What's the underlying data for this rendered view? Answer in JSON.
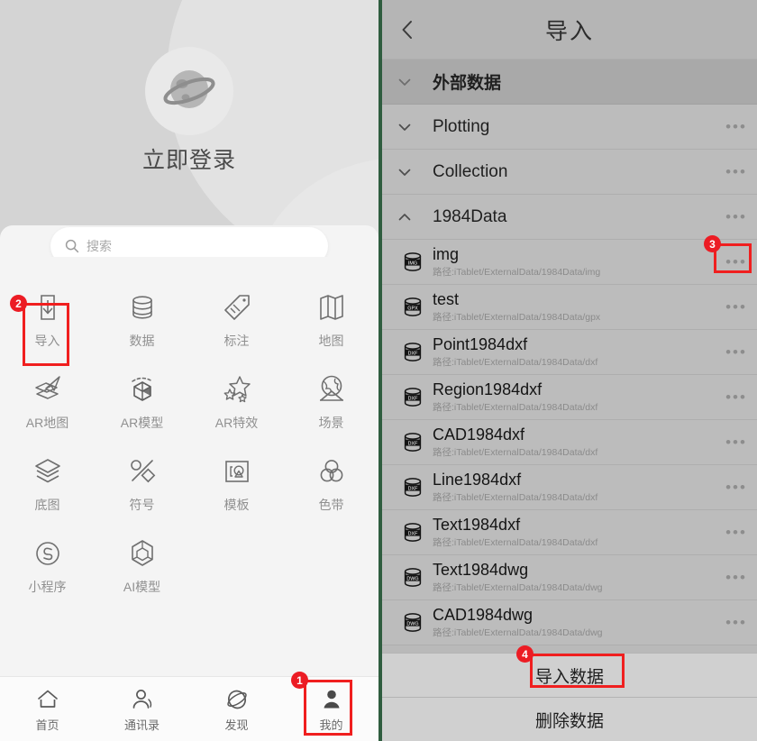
{
  "left": {
    "hero": {
      "avatar_icon": "planet-avatar-icon",
      "login_label": "立即登录"
    },
    "search": {
      "icon": "search-icon",
      "placeholder": "搜索",
      "value": ""
    },
    "grid": [
      {
        "icon": "import-download-icon",
        "label": "导入"
      },
      {
        "icon": "database-icon",
        "label": "数据"
      },
      {
        "icon": "tag-annotation-icon",
        "label": "标注"
      },
      {
        "icon": "map-icon",
        "label": "地图"
      },
      {
        "icon": "ar-map-icon",
        "label": "AR地图"
      },
      {
        "icon": "ar-model-cube-icon",
        "label": "AR模型"
      },
      {
        "icon": "ar-effect-stars-icon",
        "label": "AR特效"
      },
      {
        "icon": "scene-globe-icon",
        "label": "场景"
      },
      {
        "icon": "basemap-layers-icon",
        "label": "底图"
      },
      {
        "icon": "symbol-percent-icon",
        "label": "符号"
      },
      {
        "icon": "template-frame-icon",
        "label": "模板"
      },
      {
        "icon": "colorband-circles-icon",
        "label": "色带"
      },
      {
        "icon": "miniprogram-s-icon",
        "label": "小程序"
      },
      {
        "icon": "ai-model-cube-icon",
        "label": "AI模型"
      }
    ],
    "tabs": [
      {
        "icon": "home-icon",
        "label": "首页"
      },
      {
        "icon": "contacts-icon",
        "label": "通讯录"
      },
      {
        "icon": "discover-icon",
        "label": "发现"
      },
      {
        "icon": "profile-icon",
        "label": "我的"
      }
    ]
  },
  "right": {
    "header": {
      "back_icon": "back-chevron-icon",
      "title": "导入"
    },
    "folders": [
      {
        "name": "外部数据",
        "chevron": "chevron-down-icon",
        "section": true,
        "dots": ""
      },
      {
        "name": "Plotting",
        "chevron": "chevron-down-icon",
        "section": false,
        "dots": "•••"
      },
      {
        "name": "Collection",
        "chevron": "chevron-down-icon",
        "section": false,
        "dots": "•••"
      },
      {
        "name": "1984Data",
        "chevron": "chevron-up-icon",
        "section": false,
        "dots": "•••"
      }
    ],
    "files": [
      {
        "name": "img",
        "badge": "IMG",
        "path": "路径:iTablet/ExternalData/1984Data/img",
        "dots": "•••"
      },
      {
        "name": "test",
        "badge": "GPX",
        "path": "路径:iTablet/ExternalData/1984Data/gpx",
        "dots": "•••"
      },
      {
        "name": "Point1984dxf",
        "badge": "DXF",
        "path": "路径:iTablet/ExternalData/1984Data/dxf",
        "dots": "•••"
      },
      {
        "name": "Region1984dxf",
        "badge": "DXF",
        "path": "路径:iTablet/ExternalData/1984Data/dxf",
        "dots": "•••"
      },
      {
        "name": "CAD1984dxf",
        "badge": "DXF",
        "path": "路径:iTablet/ExternalData/1984Data/dxf",
        "dots": "•••"
      },
      {
        "name": "Line1984dxf",
        "badge": "DXF",
        "path": "路径:iTablet/ExternalData/1984Data/dxf",
        "dots": "•••"
      },
      {
        "name": "Text1984dxf",
        "badge": "DXF",
        "path": "路径:iTablet/ExternalData/1984Data/dxf",
        "dots": "•••"
      },
      {
        "name": "Text1984dwg",
        "badge": "DWG",
        "path": "路径:iTablet/ExternalData/1984Data/dwg",
        "dots": "•••"
      },
      {
        "name": "CAD1984dwg",
        "badge": "DWG",
        "path": "路径:iTablet/ExternalData/1984Data/dwg",
        "dots": "•••"
      }
    ],
    "actions": [
      {
        "label": "导入数据"
      },
      {
        "label": "删除数据"
      }
    ]
  },
  "annotations": {
    "accent_color": "#ec1c24",
    "markers": [
      {
        "number": "1",
        "target": "tab-item-profile"
      },
      {
        "number": "2",
        "target": "grid-cell-import"
      },
      {
        "number": "3",
        "target": "file-row-img-more-button"
      },
      {
        "number": "4",
        "target": "import-data-button"
      }
    ]
  }
}
